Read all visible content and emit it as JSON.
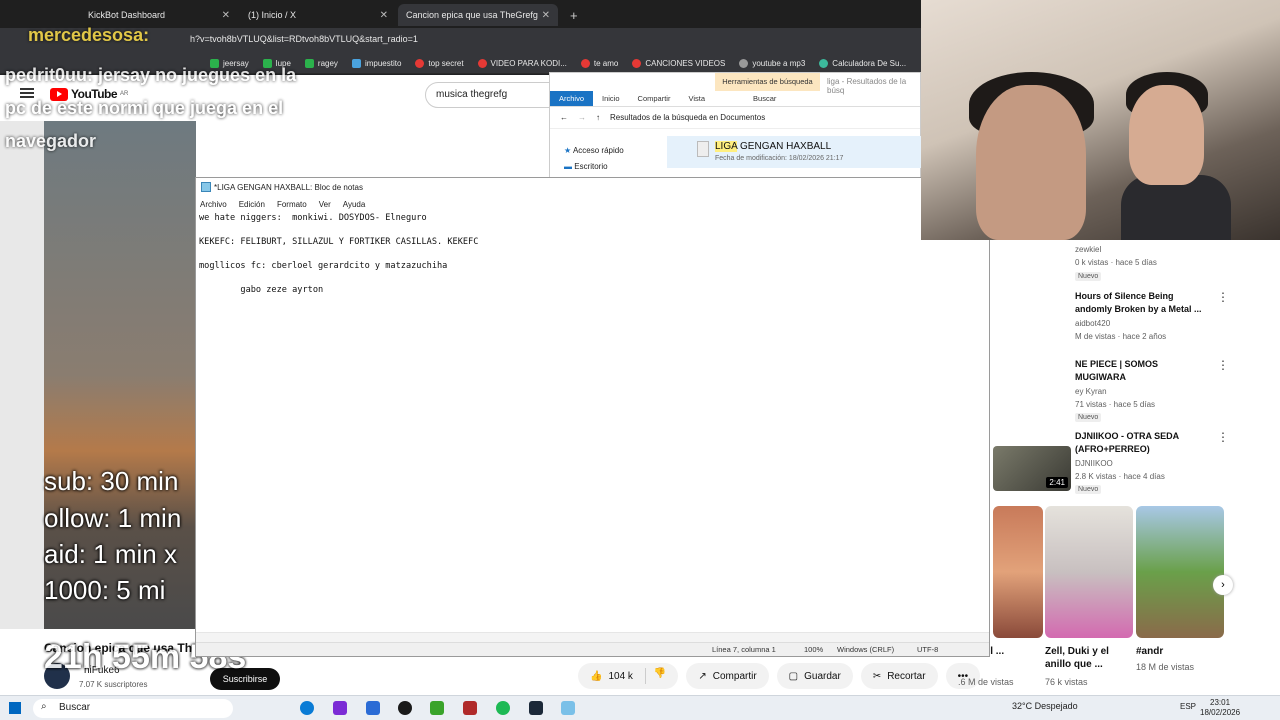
{
  "browser": {
    "tabs": [
      {
        "label": "KickBot Dashboard"
      },
      {
        "label": "(1) Inicio / X"
      },
      {
        "label": "Cancion epica que usa TheGrefg"
      }
    ],
    "url": "h?v=tvoh8bVTLUQ&list=RDtvoh8bVTLUQ&start_radio=1",
    "bookmarks": [
      "jeersay",
      "lupe",
      "ragey",
      "impuestito",
      "top secret",
      "VIDEO PARA KODI...",
      "te amo",
      "CANCIONES VIDEOS",
      "youtube a mp3",
      "Calculadora De Su..."
    ]
  },
  "youtube": {
    "logo": "YouTube",
    "country": "AR",
    "search_value": "musica thegrefg",
    "video_title": "Cancion epica que usa Th",
    "channel_name": "hiFuke6",
    "subscribers": "7.07 K suscriptores",
    "subscribe_label": "Suscribirse",
    "likes": "104 k",
    "share": "Compartir",
    "save": "Guardar",
    "clip": "Recortar"
  },
  "overlay": {
    "chat": [
      {
        "user": "mercedesosa:",
        "text": ""
      },
      {
        "user": "pedrit0uu:",
        "text": "jersay no juegues en la"
      },
      {
        "user": "",
        "text": "pc de este normi que juega en el"
      },
      {
        "user": "",
        "text": "navegador"
      }
    ],
    "timers": [
      "sub: 30 min",
      "ollow: 1 min",
      "aid: 1 min x",
      "1000: 5 mi"
    ],
    "countdown": "21h 55m 58s"
  },
  "recommendations": [
    {
      "title": "",
      "channel": "zewkiel",
      "meta": "0 k vistas · hace 5 días",
      "badge": "Nuevo"
    },
    {
      "title": "Hours of Silence Being andomly Broken by a Metal ...",
      "channel": "aidbot420",
      "meta": "M de vistas · hace 2 años",
      "badge": ""
    },
    {
      "title": "NE PIECE | SOMOS MUGIWARA",
      "channel": "ey Kyran",
      "meta": "71 vistas · hace 5 días",
      "badge": "Nuevo"
    },
    {
      "title": "DJNIIKOO - OTRA SEDA (AFRO+PERREO)",
      "channel": "DJNIIKOO",
      "meta": "2.8 K vistas · hace 4 días",
      "badge": "Nuevo",
      "duration": "2:41"
    }
  ],
  "shorts": [
    {
      "caption": "oqué el ...",
      "views": ".6 M de vistas"
    },
    {
      "caption": "Zell, Duki y el anillo que ...",
      "views": "76 k vistas"
    },
    {
      "caption": "#andr",
      "views": "18 M de vistas"
    }
  ],
  "explorer": {
    "tools_tab": "Herramientas de búsqueda",
    "title": "liga - Resultados de la búsq",
    "ribbon": [
      "Archivo",
      "Inicio",
      "Compartir",
      "Vista",
      "Buscar"
    ],
    "path": "Resultados de la búsqueda en Documentos",
    "sidebar": [
      "Acceso rápido",
      "Escritorio"
    ],
    "file_highlight": "LIGA",
    "file_name_rest": " GENGAN HAXBALL",
    "file_date": "Fecha de modificación: 18/02/2026 21:17"
  },
  "notepad": {
    "title": "*LIGA GENGAN HAXBALL: Bloc de notas",
    "menu": [
      "Archivo",
      "Edición",
      "Formato",
      "Ver",
      "Ayuda"
    ],
    "lines": [
      "we hate niggers:  monkiwi. DOSYDOS- Elneguro",
      "KEKEFC: FELIBURT, SILLAZUL Y FORTIKER CASILLAS. KEKEFC",
      "mogllicos fc: cberloel gerardcito y matzazuchiha",
      "        gabo zeze ayrton"
    ],
    "status": {
      "position": "Línea 7, columna 1",
      "zoom": "100%",
      "eol": "Windows (CRLF)",
      "encoding": "UTF-8"
    }
  },
  "taskbar": {
    "search": "Buscar",
    "weather": "32°C  Despejado",
    "lang": "ESP",
    "time": "23:01",
    "date": "18/02/2026"
  }
}
